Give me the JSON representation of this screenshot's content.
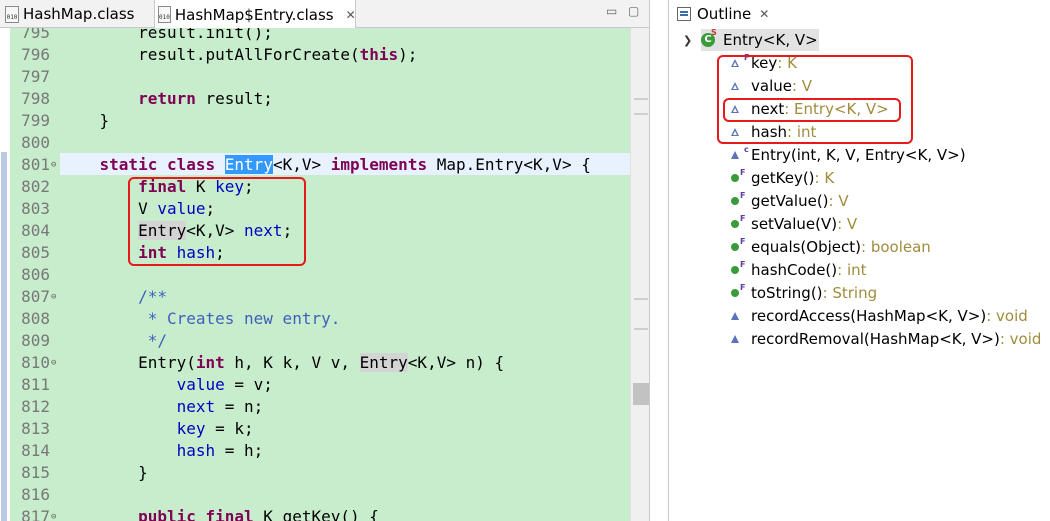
{
  "editor": {
    "tabs": [
      {
        "label": "HashMap.class",
        "icon": "class-file-icon",
        "active": false
      },
      {
        "label": "HashMap$Entry.class",
        "icon": "class-file-icon",
        "active": true,
        "close": "✕"
      }
    ],
    "lines": [
      {
        "n": "795",
        "segs": [
          {
            "t": "        result.init();",
            "c": ""
          }
        ]
      },
      {
        "n": "796",
        "segs": [
          {
            "t": "        result.putAllForCreate(",
            "c": ""
          },
          {
            "t": "this",
            "c": "kw"
          },
          {
            "t": ");",
            "c": ""
          }
        ]
      },
      {
        "n": "797",
        "segs": []
      },
      {
        "n": "798",
        "segs": [
          {
            "t": "        ",
            "c": ""
          },
          {
            "t": "return",
            "c": "kw"
          },
          {
            "t": " result;",
            "c": ""
          }
        ]
      },
      {
        "n": "799",
        "segs": [
          {
            "t": "    }",
            "c": ""
          }
        ]
      },
      {
        "n": "800",
        "segs": []
      },
      {
        "n": "801",
        "fold": "⊖",
        "segs": [
          {
            "t": "    ",
            "c": ""
          },
          {
            "t": "static",
            "c": "kw"
          },
          {
            "t": " ",
            "c": ""
          },
          {
            "t": "class",
            "c": "kw"
          },
          {
            "t": " ",
            "c": ""
          },
          {
            "t": "Entry",
            "c": "sel"
          },
          {
            "t": "<K,V> ",
            "c": ""
          },
          {
            "t": "implements",
            "c": "kw"
          },
          {
            "t": " Map.Entry<K,V> {",
            "c": ""
          }
        ]
      },
      {
        "n": "802",
        "segs": [
          {
            "t": "        ",
            "c": ""
          },
          {
            "t": "final",
            "c": "kw"
          },
          {
            "t": " K ",
            "c": ""
          },
          {
            "t": "key",
            "c": "fld"
          },
          {
            "t": ";",
            "c": ""
          }
        ]
      },
      {
        "n": "803",
        "segs": [
          {
            "t": "        V ",
            "c": ""
          },
          {
            "t": "value",
            "c": "fld"
          },
          {
            "t": ";",
            "c": ""
          }
        ]
      },
      {
        "n": "804",
        "segs": [
          {
            "t": "        ",
            "c": ""
          },
          {
            "t": "Entry",
            "c": "occ"
          },
          {
            "t": "<K,V> ",
            "c": ""
          },
          {
            "t": "next",
            "c": "fld"
          },
          {
            "t": ";",
            "c": ""
          }
        ]
      },
      {
        "n": "805",
        "segs": [
          {
            "t": "        ",
            "c": ""
          },
          {
            "t": "int",
            "c": "kw"
          },
          {
            "t": " ",
            "c": ""
          },
          {
            "t": "hash",
            "c": "fld"
          },
          {
            "t": ";",
            "c": ""
          }
        ]
      },
      {
        "n": "806",
        "segs": []
      },
      {
        "n": "807",
        "fold": "⊖",
        "segs": [
          {
            "t": "        /**",
            "c": "cm"
          }
        ]
      },
      {
        "n": "808",
        "segs": [
          {
            "t": "         * Creates new entry.",
            "c": "cm"
          }
        ]
      },
      {
        "n": "809",
        "segs": [
          {
            "t": "         */",
            "c": "cm"
          }
        ]
      },
      {
        "n": "810",
        "fold": "⊖",
        "segs": [
          {
            "t": "        Entry(",
            "c": ""
          },
          {
            "t": "int",
            "c": "kw"
          },
          {
            "t": " h, K k, V v, ",
            "c": ""
          },
          {
            "t": "Entry",
            "c": "occ"
          },
          {
            "t": "<K,V> n) {",
            "c": ""
          }
        ]
      },
      {
        "n": "811",
        "segs": [
          {
            "t": "            ",
            "c": ""
          },
          {
            "t": "value",
            "c": "fld"
          },
          {
            "t": " = v;",
            "c": ""
          }
        ]
      },
      {
        "n": "812",
        "segs": [
          {
            "t": "            ",
            "c": ""
          },
          {
            "t": "next",
            "c": "fld"
          },
          {
            "t": " = n;",
            "c": ""
          }
        ]
      },
      {
        "n": "813",
        "segs": [
          {
            "t": "            ",
            "c": ""
          },
          {
            "t": "key",
            "c": "fld"
          },
          {
            "t": " = k;",
            "c": ""
          }
        ]
      },
      {
        "n": "814",
        "segs": [
          {
            "t": "            ",
            "c": ""
          },
          {
            "t": "hash",
            "c": "fld"
          },
          {
            "t": " = h;",
            "c": ""
          }
        ]
      },
      {
        "n": "815",
        "segs": [
          {
            "t": "        }",
            "c": ""
          }
        ]
      },
      {
        "n": "816",
        "segs": []
      },
      {
        "n": "817",
        "fold": "⊖",
        "segs": [
          {
            "t": "        ",
            "c": ""
          },
          {
            "t": "public",
            "c": "kw"
          },
          {
            "t": " ",
            "c": ""
          },
          {
            "t": "final",
            "c": "kw"
          },
          {
            "t": " K getKey() {",
            "c": ""
          }
        ]
      }
    ]
  },
  "outline": {
    "title": "Outline",
    "close": "✕",
    "root": {
      "label": "Entry<K, V>",
      "icon": "static-class-icon"
    },
    "items": [
      {
        "name": "key",
        "type": " : K",
        "icon": "field-default-final-icon",
        "sup": "F"
      },
      {
        "name": "value",
        "type": " : V",
        "icon": "field-default-icon",
        "sup": ""
      },
      {
        "name": "next",
        "type": " : Entry<K, V>",
        "icon": "field-default-icon",
        "sup": ""
      },
      {
        "name": "hash",
        "type": " : int",
        "icon": "field-default-icon",
        "sup": ""
      },
      {
        "name": "Entry(int, K, V, Entry<K, V>)",
        "type": "",
        "icon": "constructor-icon",
        "sup": "c"
      },
      {
        "name": "getKey()",
        "type": " : K",
        "icon": "public-final-method-icon",
        "sup": "F"
      },
      {
        "name": "getValue()",
        "type": " : V",
        "icon": "public-final-method-icon",
        "sup": "F"
      },
      {
        "name": "setValue(V)",
        "type": " : V",
        "icon": "public-final-method-icon",
        "sup": "F"
      },
      {
        "name": "equals(Object)",
        "type": " : boolean",
        "icon": "public-final-method-icon",
        "sup": "F"
      },
      {
        "name": "hashCode()",
        "type": " : int",
        "icon": "public-final-method-icon",
        "sup": "F"
      },
      {
        "name": "toString()",
        "type": " : String",
        "icon": "public-final-method-icon",
        "sup": "F"
      },
      {
        "name": "recordAccess(HashMap<K, V>)",
        "type": " : void",
        "icon": "default-method-icon",
        "sup": ""
      },
      {
        "name": "recordRemoval(HashMap<K, V>)",
        "type": " : void",
        "icon": "default-method-icon",
        "sup": ""
      }
    ]
  },
  "colors": {
    "highlight_box": "#e8191b",
    "editor_bg": "#c7edcc",
    "keyword": "#7f0055",
    "field": "#0000c0",
    "comment": "#3f5fbf"
  }
}
